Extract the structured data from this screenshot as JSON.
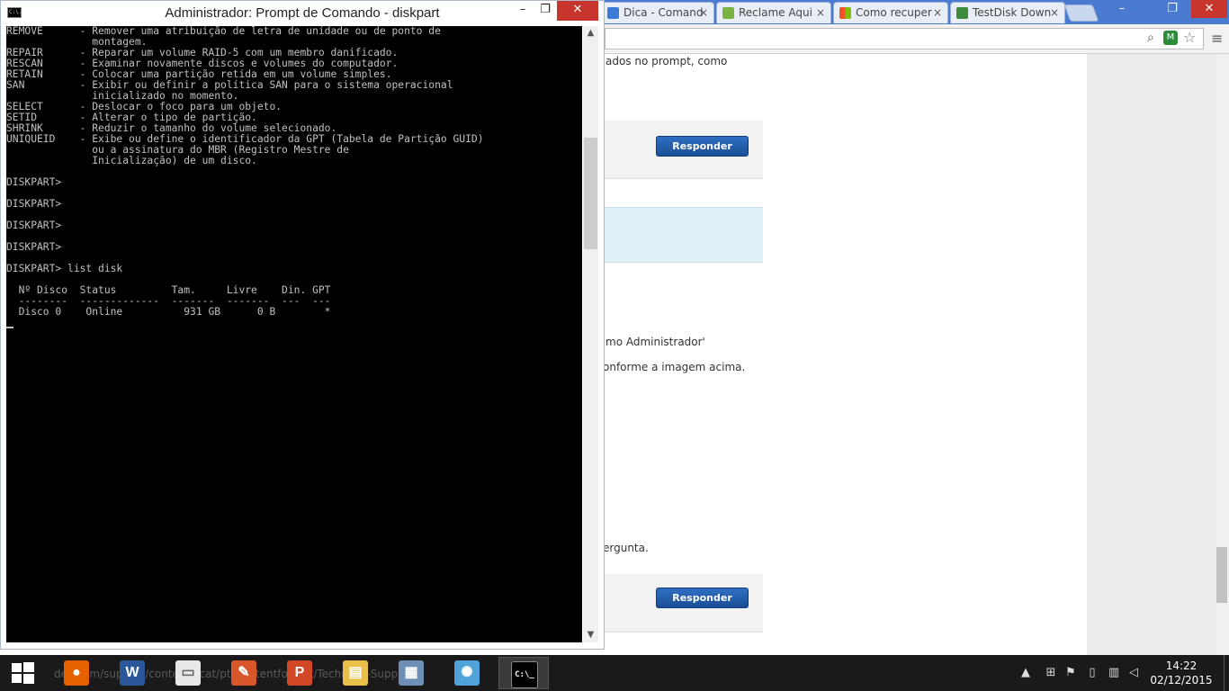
{
  "browser": {
    "tabs": [
      {
        "title": "Dica - Comand",
        "favicon_color": "#3b7bd5"
      },
      {
        "title": "Reclame Aqui",
        "favicon_color": "#7bb342"
      },
      {
        "title": "Como recuper",
        "favicon_color": "#f35325"
      },
      {
        "title": "TestDisk Down",
        "favicon_color": "#3c8a3c"
      }
    ],
    "close_glyph": "×",
    "window_controls": [
      "–",
      "❐",
      "✕"
    ]
  },
  "page": {
    "fragments": [
      "ados no prompt, como",
      "mo Administrador'",
      "onforme a imagem acima.",
      "ergunta."
    ],
    "respond_label": "Responder"
  },
  "cmd": {
    "title": "Administrador: Prompt de Comando - diskpart",
    "icon_label": "C:\\.",
    "window_controls": [
      "–",
      "❐",
      "✕"
    ],
    "lines": [
      "REMOVE      - Remover uma atribuição de letra de unidade ou de ponto de",
      "              montagem.",
      "REPAIR      - Reparar um volume RAID-5 com um membro danificado.",
      "RESCAN      - Examinar novamente discos e volumes do computador.",
      "RETAIN      - Colocar uma partição retida em um volume simples.",
      "SAN         - Exibir ou definir a política SAN para o sistema operacional",
      "              inicializado no momento.",
      "SELECT      - Deslocar o foco para um objeto.",
      "SETID       - Alterar o tipo de partição.",
      "SHRINK      - Reduzir o tamanho do volume selecionado.",
      "UNIQUEID    - Exibe ou define o identificador da GPT (Tabela de Partição GUID)",
      "              ou a assinatura do MBR (Registro Mestre de",
      "              Inicialização) de um disco.",
      "",
      "DISKPART>",
      "",
      "DISKPART>",
      "",
      "DISKPART>",
      "",
      "DISKPART>",
      "",
      "DISKPART> list disk",
      "",
      "  Nº Disco  Status         Tam.     Livre    Din. GPT",
      "  --------  -------------  -------  -------  ---  ---",
      "  Disco 0    Online          931 GB      0 B        *"
    ]
  },
  "taskbar": {
    "ghost_text": "dell.com/support/contents/cat/pt/Contentformat/Technical-Support",
    "apps": [
      {
        "name": "firefox",
        "glyph": "●",
        "color": "#e66000"
      },
      {
        "name": "word",
        "glyph": "W",
        "color": "#2b579a"
      },
      {
        "name": "notepad",
        "glyph": "▭",
        "color": "#e8e8e8"
      },
      {
        "name": "paint-app",
        "glyph": "✎",
        "color": "#d8572a"
      },
      {
        "name": "powerpoint",
        "glyph": "P",
        "color": "#d24726"
      },
      {
        "name": "explorer",
        "glyph": "▤",
        "color": "#e8c04a"
      },
      {
        "name": "calculator",
        "glyph": "▦",
        "color": "#6d8fb6"
      },
      {
        "name": "paint",
        "glyph": "✺",
        "color": "#4fa3d9"
      },
      {
        "name": "cmd",
        "glyph": "C:\\_",
        "color": "#000000"
      }
    ],
    "clock_time": "14:22",
    "clock_date": "02/12/2015"
  }
}
